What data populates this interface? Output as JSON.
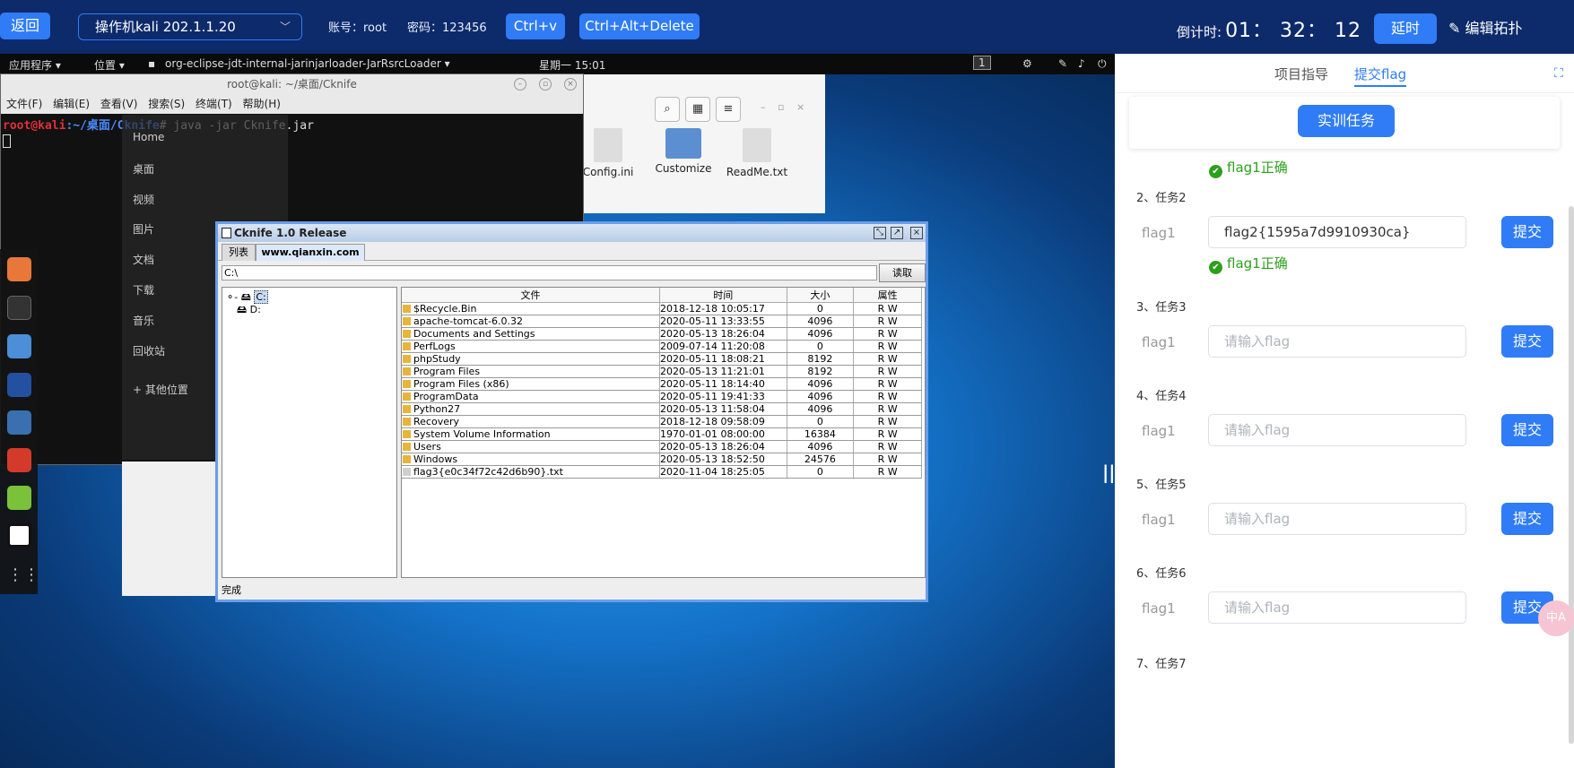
{
  "topbar": {
    "back": "返回",
    "vm": "操作机kali 202.1.1.20",
    "account": "账号：root",
    "password": "密码：123456",
    "ctrlv": "Ctrl+v",
    "cad": "Ctrl+Alt+Delete",
    "countdown_label": "倒计时:",
    "countdown_value": "01： 32： 12",
    "extend": "延时",
    "edit_topo": "编辑拓扑"
  },
  "kali_panel": {
    "apps": "应用程序 ▾",
    "places": "位置 ▾",
    "window": "org-eclipse-jdt-internal-jarinjarloader-JarRsrcLoader ▾",
    "clock": "星期一 15:01",
    "workspace": "1"
  },
  "terminal": {
    "title": "root@kali: ~/桌面/Cknife",
    "menu": "文件(F) 编辑(E) 查看(V) 搜索(S) 终端(T) 帮助(H)",
    "prompt_user": "root@kali",
    "prompt_path": ":~/桌面/Cknife",
    "command": "# java -jar Cknife.jar"
  },
  "filemanager": {
    "sidebar": [
      "Home",
      "桌面",
      "视频",
      "图片",
      "文档",
      "下载",
      "音乐",
      "回收站",
      "+ 其他位置"
    ],
    "files": [
      "Config.ini",
      "Customize",
      "ReadMe.txt"
    ]
  },
  "cknife": {
    "title": "Cknife 1.0 Release",
    "tab_list": "列表",
    "tab_site": "www.qianxin.com",
    "path": "C:\\",
    "read": "读取",
    "tree": [
      "C:",
      "D:"
    ],
    "status": "完成",
    "columns": [
      "文件",
      "时间",
      "大小",
      "属性"
    ],
    "rows": [
      [
        "$Recycle.Bin",
        "2018-12-18 10:05:17",
        "0",
        "R W"
      ],
      [
        "apache-tomcat-6.0.32",
        "2020-05-11 13:33:55",
        "4096",
        "R W"
      ],
      [
        "Documents and Settings",
        "2020-05-13 18:26:04",
        "4096",
        "R W"
      ],
      [
        "PerfLogs",
        "2009-07-14 11:20:08",
        "0",
        "R W"
      ],
      [
        "phpStudy",
        "2020-05-11 18:08:21",
        "8192",
        "R W"
      ],
      [
        "Program Files",
        "2020-05-13 11:21:01",
        "8192",
        "R W"
      ],
      [
        "Program Files (x86)",
        "2020-05-11 18:14:40",
        "4096",
        "R W"
      ],
      [
        "ProgramData",
        "2020-05-11 19:41:33",
        "4096",
        "R W"
      ],
      [
        "Python27",
        "2020-05-13 11:58:04",
        "4096",
        "R W"
      ],
      [
        "Recovery",
        "2018-12-18 09:58:09",
        "0",
        "R W"
      ],
      [
        "System Volume Information",
        "1970-01-01 08:00:00",
        "16384",
        "R W"
      ],
      [
        "Users",
        "2020-05-13 18:26:04",
        "4096",
        "R W"
      ],
      [
        "Windows",
        "2020-05-13 18:52:50",
        "24576",
        "R W"
      ],
      [
        "flag3{e0c34f72c42d6b90}.txt",
        "2020-11-04 18:25:05",
        "0",
        "R W"
      ]
    ]
  },
  "panel": {
    "tab_guide": "项目指导",
    "tab_flag": "提交flag",
    "task_button": "实训任务",
    "ok_text": "flag1正确",
    "flag_label": "flag1",
    "placeholder": "请输入flag",
    "submit": "提交",
    "tasks": [
      {
        "title": "2、任务2",
        "value": "flag2{1595a7d9910930ca}"
      },
      {
        "title": "3、任务3"
      },
      {
        "title": "4、任务4"
      },
      {
        "title": "5、任务5"
      },
      {
        "title": "6、任务6"
      },
      {
        "title": "7、任务7"
      }
    ]
  }
}
